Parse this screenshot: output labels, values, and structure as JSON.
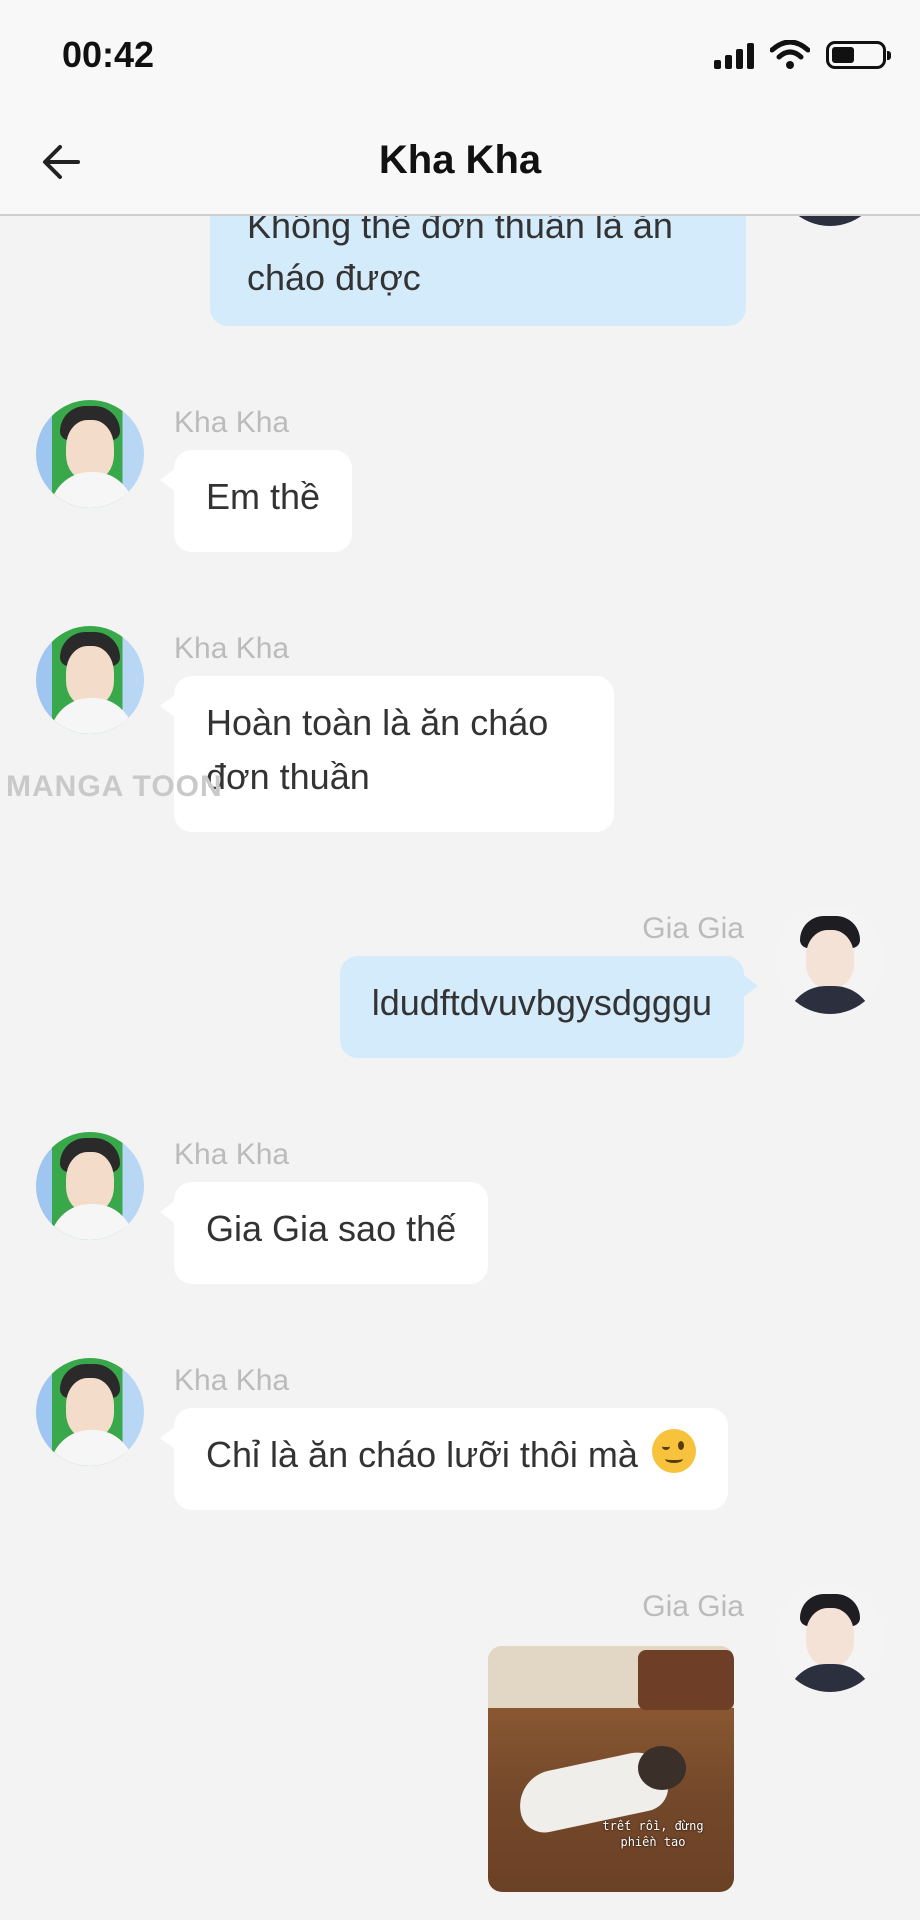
{
  "status_bar": {
    "time": "00:42"
  },
  "header": {
    "title": "Kha Kha"
  },
  "watermark": "MANGA TOON",
  "messages": [
    {
      "sender": "",
      "text_lines": [
        "Không thể đơn thuần là ăn",
        "cháo được"
      ]
    },
    {
      "sender": "Kha Kha",
      "text": "Em thề"
    },
    {
      "sender": "Kha Kha",
      "text_lines": [
        "Hoàn toàn là ăn cháo",
        "đơn thuần"
      ]
    },
    {
      "sender": "Gia Gia",
      "text": "ldudftdvuvbgysdgggu"
    },
    {
      "sender": "Kha Kha",
      "text": "Gia Gia sao thế"
    },
    {
      "sender": "Kha Kha",
      "text": "Chỉ là ăn cháo lưỡi thôi mà"
    },
    {
      "sender": "Gia Gia",
      "image_caption": [
        "trết rồi, đừng",
        "phiền tao"
      ]
    }
  ],
  "colors": {
    "incoming_bubble": "#ffffff",
    "outgoing_bubble": "#d4ebfb",
    "background": "#f3f3f3"
  }
}
